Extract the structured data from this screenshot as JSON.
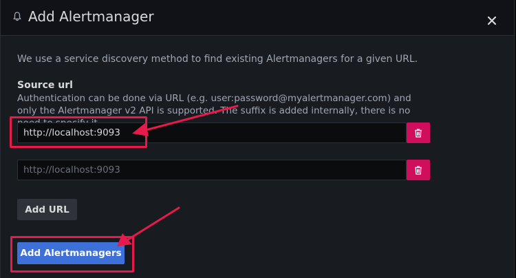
{
  "modal": {
    "title": "Add Alertmanager",
    "icons": {
      "title": "bell-icon",
      "close": "close-icon",
      "remove": "trash-icon"
    }
  },
  "content": {
    "description": "We use a service discovery method to find existing Alertmanagers for a given URL.",
    "source_url_label": "Source url",
    "source_url_hint": "Authentication can be done via URL (e.g. user:password@myalertmanager.com) and only the Alertmanager v2 API is supported. The suffix is added internally, there is no need to specify it."
  },
  "urls": [
    {
      "value": "http://localhost:9093",
      "placeholder": ""
    },
    {
      "value": "",
      "placeholder": "http://localhost:9093"
    }
  ],
  "buttons": {
    "add_url": "Add URL",
    "add_alertmanagers": "Add Alertmanagers"
  },
  "colors": {
    "primary": "#3d71d9",
    "destructive": "#d10e5c",
    "annotation": "#e8194b"
  }
}
